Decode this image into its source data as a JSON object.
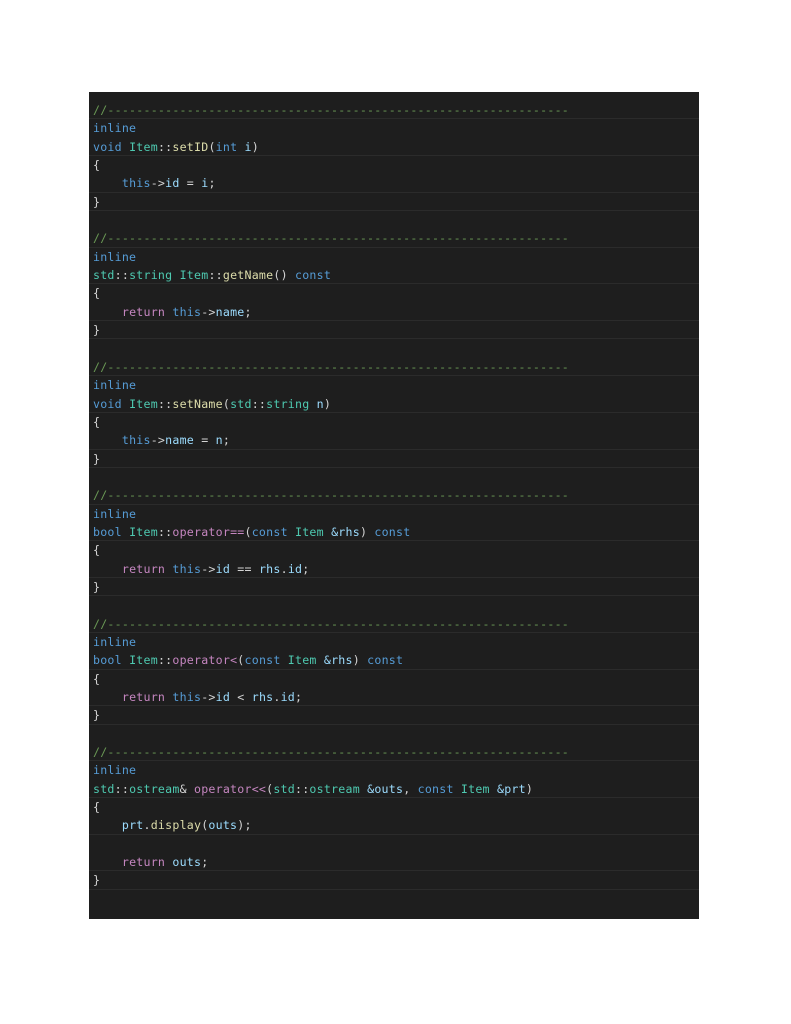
{
  "document": {
    "language": "C++",
    "theme": "dark",
    "background": "#ffffff",
    "editor_background": "#1e1e1e",
    "default_text_color": "#d4d4d4"
  },
  "colors": {
    "comment": "#6A9955",
    "keyword": "#569CD6",
    "type": "#4EC9B0",
    "function": "#DCDCAA",
    "variable": "#9CDCFE",
    "control": "#C586C0",
    "operator": "#d4d4d4",
    "row_separator": "#2b2b2b"
  },
  "code": {
    "separator_comment": "//----------------------------------------------------------------",
    "lines": [
      {
        "id": "l1",
        "text": "//----------------------------------------------------------------",
        "tokens": [
          {
            "t": "//----------------------------------------------------------------",
            "c": "cmt"
          }
        ]
      },
      {
        "id": "l2",
        "text": "inline",
        "tokens": [
          {
            "t": "inline",
            "c": "kw"
          }
        ]
      },
      {
        "id": "l3",
        "text": "void Item::setID(int i)",
        "tokens": [
          {
            "t": "void",
            "c": "kw"
          },
          {
            "t": " ",
            "c": "punc"
          },
          {
            "t": "Item",
            "c": "type"
          },
          {
            "t": "::",
            "c": "punc"
          },
          {
            "t": "setID",
            "c": "fn"
          },
          {
            "t": "(",
            "c": "punc"
          },
          {
            "t": "int",
            "c": "kw"
          },
          {
            "t": " ",
            "c": "punc"
          },
          {
            "t": "i",
            "c": "var"
          },
          {
            "t": ")",
            "c": "punc"
          }
        ]
      },
      {
        "id": "l4",
        "text": "{",
        "tokens": [
          {
            "t": "{",
            "c": "punc"
          }
        ]
      },
      {
        "id": "l5",
        "text": "    this->id = i;",
        "tokens": [
          {
            "t": "    ",
            "c": "punc"
          },
          {
            "t": "this",
            "c": "kw"
          },
          {
            "t": "->",
            "c": "op"
          },
          {
            "t": "id",
            "c": "var"
          },
          {
            "t": " = ",
            "c": "op"
          },
          {
            "t": "i",
            "c": "var"
          },
          {
            "t": ";",
            "c": "punc"
          }
        ]
      },
      {
        "id": "l6",
        "text": "}",
        "tokens": [
          {
            "t": "}",
            "c": "punc"
          }
        ]
      },
      {
        "id": "l7",
        "text": "",
        "tokens": []
      },
      {
        "id": "l8",
        "text": "//----------------------------------------------------------------",
        "tokens": [
          {
            "t": "//----------------------------------------------------------------",
            "c": "cmt"
          }
        ]
      },
      {
        "id": "l9",
        "text": "inline",
        "tokens": [
          {
            "t": "inline",
            "c": "kw"
          }
        ]
      },
      {
        "id": "l10",
        "text": "std::string Item::getName() const",
        "tokens": [
          {
            "t": "std",
            "c": "type"
          },
          {
            "t": "::",
            "c": "punc"
          },
          {
            "t": "string",
            "c": "type"
          },
          {
            "t": " ",
            "c": "punc"
          },
          {
            "t": "Item",
            "c": "type"
          },
          {
            "t": "::",
            "c": "punc"
          },
          {
            "t": "getName",
            "c": "fn"
          },
          {
            "t": "() ",
            "c": "punc"
          },
          {
            "t": "const",
            "c": "kw"
          }
        ]
      },
      {
        "id": "l11",
        "text": "{",
        "tokens": [
          {
            "t": "{",
            "c": "punc"
          }
        ]
      },
      {
        "id": "l12",
        "text": "    return this->name;",
        "tokens": [
          {
            "t": "    ",
            "c": "punc"
          },
          {
            "t": "return",
            "c": "ctl"
          },
          {
            "t": " ",
            "c": "punc"
          },
          {
            "t": "this",
            "c": "kw"
          },
          {
            "t": "->",
            "c": "op"
          },
          {
            "t": "name",
            "c": "var"
          },
          {
            "t": ";",
            "c": "punc"
          }
        ]
      },
      {
        "id": "l13",
        "text": "}",
        "tokens": [
          {
            "t": "}",
            "c": "punc"
          }
        ]
      },
      {
        "id": "l14",
        "text": "",
        "tokens": []
      },
      {
        "id": "l15",
        "text": "//----------------------------------------------------------------",
        "tokens": [
          {
            "t": "//----------------------------------------------------------------",
            "c": "cmt"
          }
        ]
      },
      {
        "id": "l16",
        "text": "inline",
        "tokens": [
          {
            "t": "inline",
            "c": "kw"
          }
        ]
      },
      {
        "id": "l17",
        "text": "void Item::setName(std::string n)",
        "tokens": [
          {
            "t": "void",
            "c": "kw"
          },
          {
            "t": " ",
            "c": "punc"
          },
          {
            "t": "Item",
            "c": "type"
          },
          {
            "t": "::",
            "c": "punc"
          },
          {
            "t": "setName",
            "c": "fn"
          },
          {
            "t": "(",
            "c": "punc"
          },
          {
            "t": "std",
            "c": "type"
          },
          {
            "t": "::",
            "c": "punc"
          },
          {
            "t": "string",
            "c": "type"
          },
          {
            "t": " ",
            "c": "punc"
          },
          {
            "t": "n",
            "c": "var"
          },
          {
            "t": ")",
            "c": "punc"
          }
        ]
      },
      {
        "id": "l18",
        "text": "{",
        "tokens": [
          {
            "t": "{",
            "c": "punc"
          }
        ]
      },
      {
        "id": "l19",
        "text": "    this->name = n;",
        "tokens": [
          {
            "t": "    ",
            "c": "punc"
          },
          {
            "t": "this",
            "c": "kw"
          },
          {
            "t": "->",
            "c": "op"
          },
          {
            "t": "name",
            "c": "var"
          },
          {
            "t": " = ",
            "c": "op"
          },
          {
            "t": "n",
            "c": "var"
          },
          {
            "t": ";",
            "c": "punc"
          }
        ]
      },
      {
        "id": "l20",
        "text": "}",
        "tokens": [
          {
            "t": "}",
            "c": "punc"
          }
        ]
      },
      {
        "id": "l21",
        "text": "",
        "tokens": []
      },
      {
        "id": "l22",
        "text": "//----------------------------------------------------------------",
        "tokens": [
          {
            "t": "//----------------------------------------------------------------",
            "c": "cmt"
          }
        ]
      },
      {
        "id": "l23",
        "text": "inline",
        "tokens": [
          {
            "t": "inline",
            "c": "kw"
          }
        ]
      },
      {
        "id": "l24",
        "text": "bool Item::operator==(const Item &rhs) const",
        "tokens": [
          {
            "t": "bool",
            "c": "kw"
          },
          {
            "t": " ",
            "c": "punc"
          },
          {
            "t": "Item",
            "c": "type"
          },
          {
            "t": "::",
            "c": "punc"
          },
          {
            "t": "operator==",
            "c": "ctl"
          },
          {
            "t": "(",
            "c": "punc"
          },
          {
            "t": "const",
            "c": "kw"
          },
          {
            "t": " ",
            "c": "punc"
          },
          {
            "t": "Item",
            "c": "type"
          },
          {
            "t": " ",
            "c": "punc"
          },
          {
            "t": "&rhs",
            "c": "var"
          },
          {
            "t": ") ",
            "c": "punc"
          },
          {
            "t": "const",
            "c": "kw"
          }
        ]
      },
      {
        "id": "l25",
        "text": "{",
        "tokens": [
          {
            "t": "{",
            "c": "punc"
          }
        ]
      },
      {
        "id": "l26",
        "text": "    return this->id == rhs.id;",
        "tokens": [
          {
            "t": "    ",
            "c": "punc"
          },
          {
            "t": "return",
            "c": "ctl"
          },
          {
            "t": " ",
            "c": "punc"
          },
          {
            "t": "this",
            "c": "kw"
          },
          {
            "t": "->",
            "c": "op"
          },
          {
            "t": "id",
            "c": "var"
          },
          {
            "t": " == ",
            "c": "op"
          },
          {
            "t": "rhs",
            "c": "var"
          },
          {
            "t": ".",
            "c": "punc"
          },
          {
            "t": "id",
            "c": "var"
          },
          {
            "t": ";",
            "c": "punc"
          }
        ]
      },
      {
        "id": "l27",
        "text": "}",
        "tokens": [
          {
            "t": "}",
            "c": "punc"
          }
        ]
      },
      {
        "id": "l28",
        "text": "",
        "tokens": []
      },
      {
        "id": "l29",
        "text": "//----------------------------------------------------------------",
        "tokens": [
          {
            "t": "//----------------------------------------------------------------",
            "c": "cmt"
          }
        ]
      },
      {
        "id": "l30",
        "text": "inline",
        "tokens": [
          {
            "t": "inline",
            "c": "kw"
          }
        ]
      },
      {
        "id": "l31",
        "text": "bool Item::operator<(const Item &rhs) const",
        "tokens": [
          {
            "t": "bool",
            "c": "kw"
          },
          {
            "t": " ",
            "c": "punc"
          },
          {
            "t": "Item",
            "c": "type"
          },
          {
            "t": "::",
            "c": "punc"
          },
          {
            "t": "operator<",
            "c": "ctl"
          },
          {
            "t": "(",
            "c": "punc"
          },
          {
            "t": "const",
            "c": "kw"
          },
          {
            "t": " ",
            "c": "punc"
          },
          {
            "t": "Item",
            "c": "type"
          },
          {
            "t": " ",
            "c": "punc"
          },
          {
            "t": "&rhs",
            "c": "var"
          },
          {
            "t": ") ",
            "c": "punc"
          },
          {
            "t": "const",
            "c": "kw"
          }
        ]
      },
      {
        "id": "l32",
        "text": "{",
        "tokens": [
          {
            "t": "{",
            "c": "punc"
          }
        ]
      },
      {
        "id": "l33",
        "text": "    return this->id < rhs.id;",
        "tokens": [
          {
            "t": "    ",
            "c": "punc"
          },
          {
            "t": "return",
            "c": "ctl"
          },
          {
            "t": " ",
            "c": "punc"
          },
          {
            "t": "this",
            "c": "kw"
          },
          {
            "t": "->",
            "c": "op"
          },
          {
            "t": "id",
            "c": "var"
          },
          {
            "t": " < ",
            "c": "op"
          },
          {
            "t": "rhs",
            "c": "var"
          },
          {
            "t": ".",
            "c": "punc"
          },
          {
            "t": "id",
            "c": "var"
          },
          {
            "t": ";",
            "c": "punc"
          }
        ]
      },
      {
        "id": "l34",
        "text": "}",
        "tokens": [
          {
            "t": "}",
            "c": "punc"
          }
        ]
      },
      {
        "id": "l35",
        "text": "",
        "tokens": []
      },
      {
        "id": "l36",
        "text": "//----------------------------------------------------------------",
        "tokens": [
          {
            "t": "//----------------------------------------------------------------",
            "c": "cmt"
          }
        ]
      },
      {
        "id": "l37",
        "text": "inline",
        "tokens": [
          {
            "t": "inline",
            "c": "kw"
          }
        ]
      },
      {
        "id": "l38",
        "text": "std::ostream& operator<<(std::ostream &outs, const Item &prt)",
        "tokens": [
          {
            "t": "std",
            "c": "type"
          },
          {
            "t": "::",
            "c": "punc"
          },
          {
            "t": "ostream",
            "c": "type"
          },
          {
            "t": "& ",
            "c": "op"
          },
          {
            "t": "operator<<",
            "c": "ctl"
          },
          {
            "t": "(",
            "c": "punc"
          },
          {
            "t": "std",
            "c": "type"
          },
          {
            "t": "::",
            "c": "punc"
          },
          {
            "t": "ostream",
            "c": "type"
          },
          {
            "t": " ",
            "c": "punc"
          },
          {
            "t": "&outs",
            "c": "var"
          },
          {
            "t": ", ",
            "c": "punc"
          },
          {
            "t": "const",
            "c": "kw"
          },
          {
            "t": " ",
            "c": "punc"
          },
          {
            "t": "Item",
            "c": "type"
          },
          {
            "t": " ",
            "c": "punc"
          },
          {
            "t": "&prt",
            "c": "var"
          },
          {
            "t": ")",
            "c": "punc"
          }
        ]
      },
      {
        "id": "l39",
        "text": "{",
        "tokens": [
          {
            "t": "{",
            "c": "punc"
          }
        ]
      },
      {
        "id": "l40",
        "text": "    prt.display(outs);",
        "tokens": [
          {
            "t": "    ",
            "c": "punc"
          },
          {
            "t": "prt",
            "c": "var"
          },
          {
            "t": ".",
            "c": "punc"
          },
          {
            "t": "display",
            "c": "fn"
          },
          {
            "t": "(",
            "c": "punc"
          },
          {
            "t": "outs",
            "c": "var"
          },
          {
            "t": ");",
            "c": "punc"
          }
        ]
      },
      {
        "id": "l41",
        "text": "",
        "tokens": []
      },
      {
        "id": "l42",
        "text": "    return outs;",
        "tokens": [
          {
            "t": "    ",
            "c": "punc"
          },
          {
            "t": "return",
            "c": "ctl"
          },
          {
            "t": " ",
            "c": "punc"
          },
          {
            "t": "outs",
            "c": "var"
          },
          {
            "t": ";",
            "c": "punc"
          }
        ]
      },
      {
        "id": "l43",
        "text": "}",
        "tokens": [
          {
            "t": "}",
            "c": "punc"
          }
        ]
      },
      {
        "id": "l44",
        "text": "",
        "tokens": []
      }
    ],
    "separator_rows": [
      1,
      3,
      5,
      6,
      8,
      10,
      12,
      13,
      15,
      17,
      19,
      20,
      22,
      24,
      26,
      27,
      29,
      31,
      33,
      34,
      36,
      38,
      40,
      42,
      43
    ]
  }
}
